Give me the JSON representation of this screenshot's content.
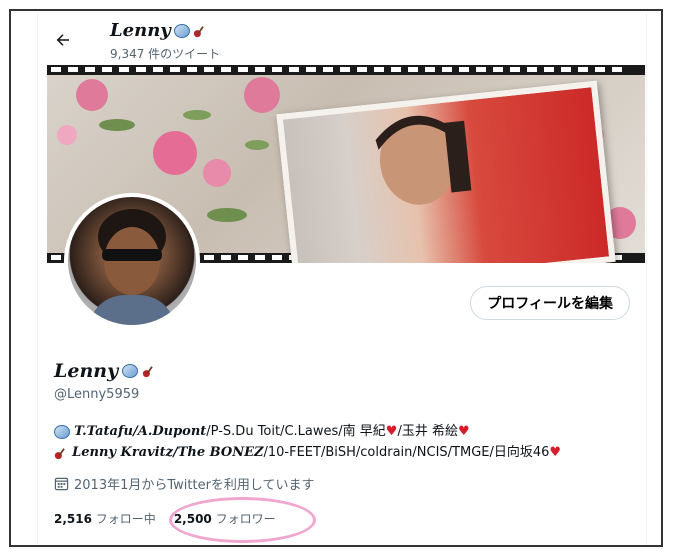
{
  "header": {
    "back_label": "",
    "name": "Lenny",
    "tweet_count": "9,347 件のツイート"
  },
  "profile": {
    "edit_button": "プロフィールを編集",
    "display_name": "Lenny",
    "handle": "@Lenny5959",
    "bio_line1_bold": "T.Tatafu/A.Dupont",
    "bio_line1_rest": "/P-S.Du Toit/C.Lawes/南 早紀",
    "bio_line1_tail": "/玉井 希絵",
    "bio_line2_bold": "Lenny Kravitz/The BONEZ",
    "bio_line2_rest": "/10-FEET/BiSH/coldrain/NCIS/TMGE/日向坂46",
    "joined": "2013年1月からTwitterを利用しています"
  },
  "stats": {
    "following_count": "2,516",
    "following_label": "フォロー中",
    "followers_count": "2,500",
    "followers_label": "フォロワー"
  },
  "colors": {
    "text": "#0f1419",
    "secondary": "#536471",
    "highlight_circle": "#f0a6cf",
    "heart": "#d71b2a"
  },
  "icons": [
    "back-arrow-icon",
    "rugby-ball-icon",
    "guitar-icon",
    "calendar-icon",
    "heart-icon"
  ]
}
